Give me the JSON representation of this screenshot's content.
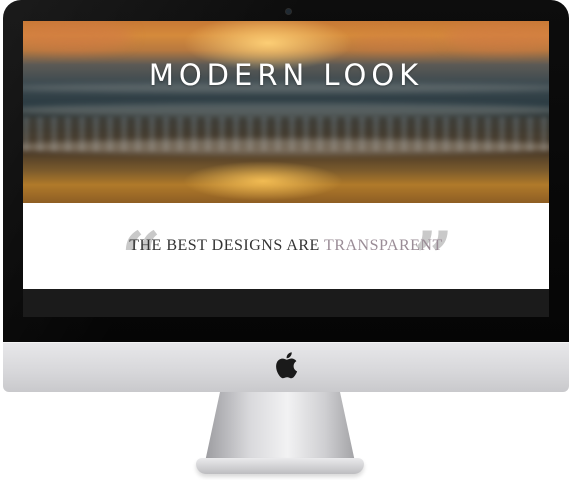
{
  "hero": {
    "title": "MODERN LOOK"
  },
  "panel": {
    "tagline_main": "THE BEST DESIGNS ARE ",
    "tagline_accent": "TRANSPARENT",
    "quote_open": "“",
    "quote_close": "”"
  },
  "device": {
    "logo_icon": "apple-logo-icon"
  },
  "colors": {
    "accent": "#9a8c96",
    "tagline_text": "#333333",
    "footer_bar": "#1b1b1b",
    "quote_marks": "#c9c9c9"
  }
}
